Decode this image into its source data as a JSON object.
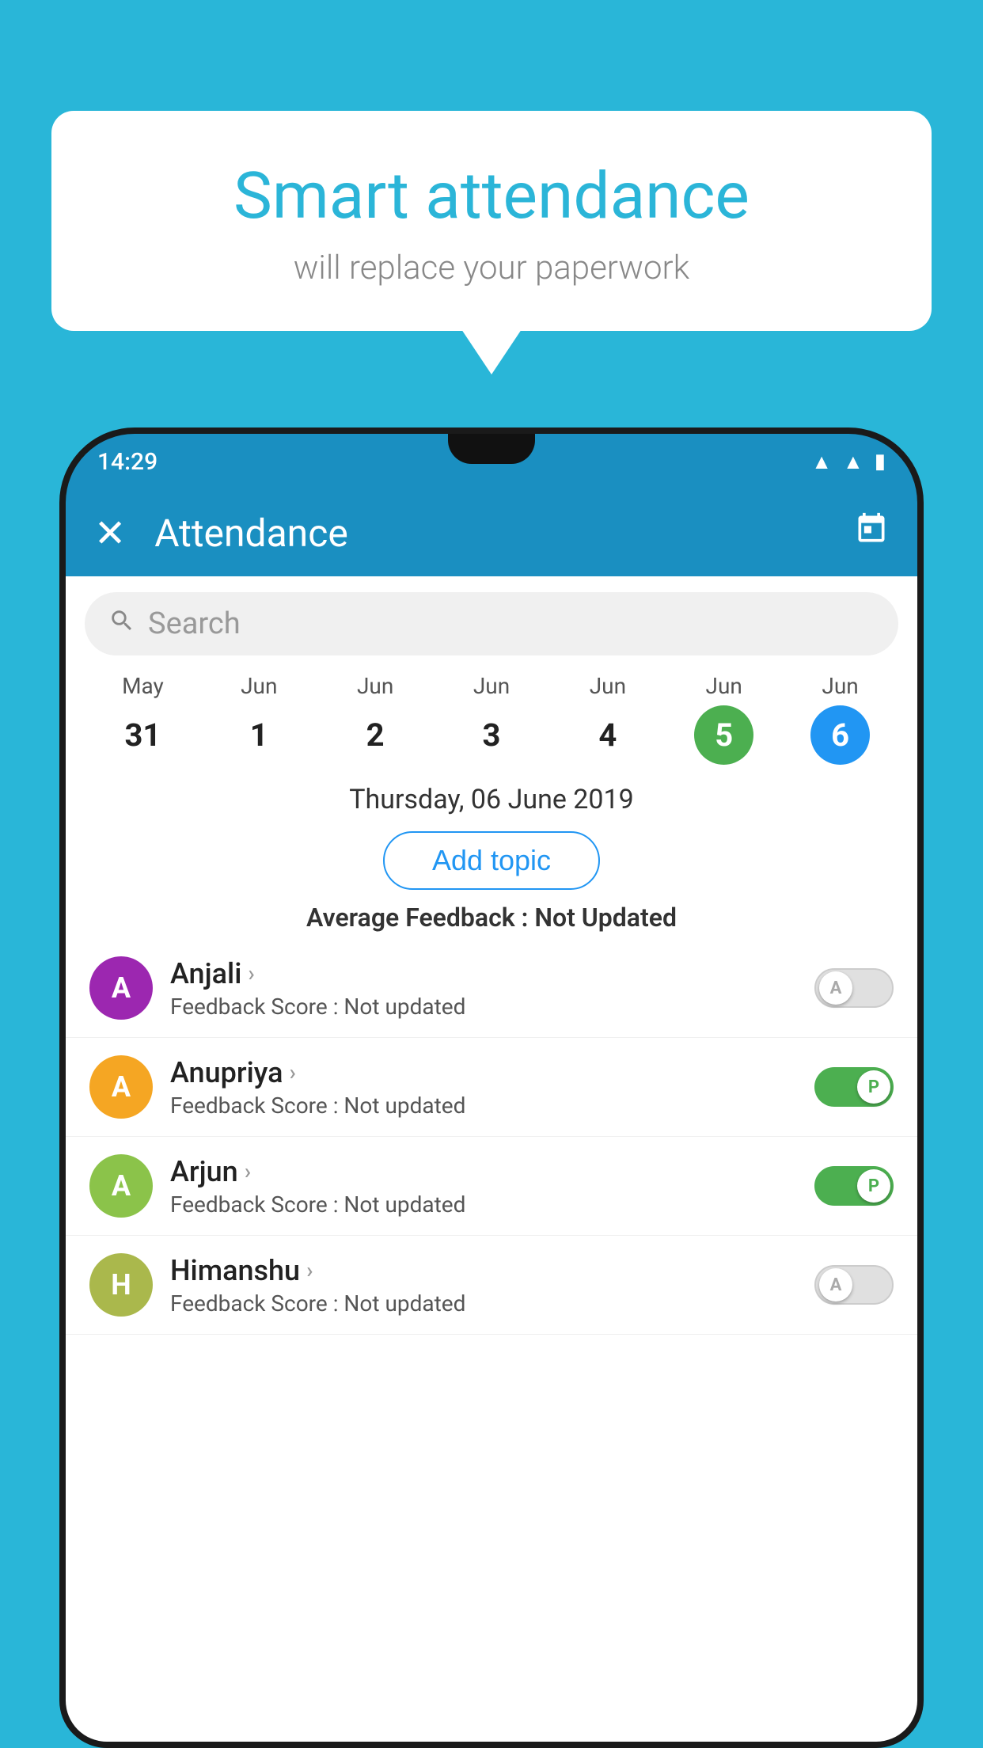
{
  "background": {
    "color": "#29b6d8"
  },
  "speech_bubble": {
    "title": "Smart attendance",
    "subtitle": "will replace your paperwork"
  },
  "status_bar": {
    "time": "14:29",
    "icons": [
      "wifi",
      "signal",
      "battery"
    ]
  },
  "app_bar": {
    "close_label": "✕",
    "title": "Attendance",
    "calendar_icon": "📅"
  },
  "search": {
    "placeholder": "Search"
  },
  "calendar": {
    "days": [
      {
        "month": "May",
        "date": "31",
        "state": "normal"
      },
      {
        "month": "Jun",
        "date": "1",
        "state": "normal"
      },
      {
        "month": "Jun",
        "date": "2",
        "state": "normal"
      },
      {
        "month": "Jun",
        "date": "3",
        "state": "normal"
      },
      {
        "month": "Jun",
        "date": "4",
        "state": "normal"
      },
      {
        "month": "Jun",
        "date": "5",
        "state": "today"
      },
      {
        "month": "Jun",
        "date": "6",
        "state": "selected"
      }
    ]
  },
  "selected_date_label": "Thursday, 06 June 2019",
  "add_topic_button": "Add topic",
  "avg_feedback": {
    "label": "Average Feedback : ",
    "value": "Not Updated"
  },
  "students": [
    {
      "name": "Anjali",
      "initial": "A",
      "avatar_color": "#9c27b0",
      "feedback_label": "Feedback Score : ",
      "feedback_value": "Not updated",
      "toggle_state": "off",
      "toggle_label": "A"
    },
    {
      "name": "Anupriya",
      "initial": "A",
      "avatar_color": "#f5a623",
      "feedback_label": "Feedback Score : ",
      "feedback_value": "Not updated",
      "toggle_state": "on",
      "toggle_label": "P"
    },
    {
      "name": "Arjun",
      "initial": "A",
      "avatar_color": "#8bc34a",
      "feedback_label": "Feedback Score : ",
      "feedback_value": "Not updated",
      "toggle_state": "on",
      "toggle_label": "P"
    },
    {
      "name": "Himanshu",
      "initial": "H",
      "avatar_color": "#aab84c",
      "feedback_label": "Feedback Score : ",
      "feedback_value": "Not updated",
      "toggle_state": "off",
      "toggle_label": "A"
    }
  ]
}
